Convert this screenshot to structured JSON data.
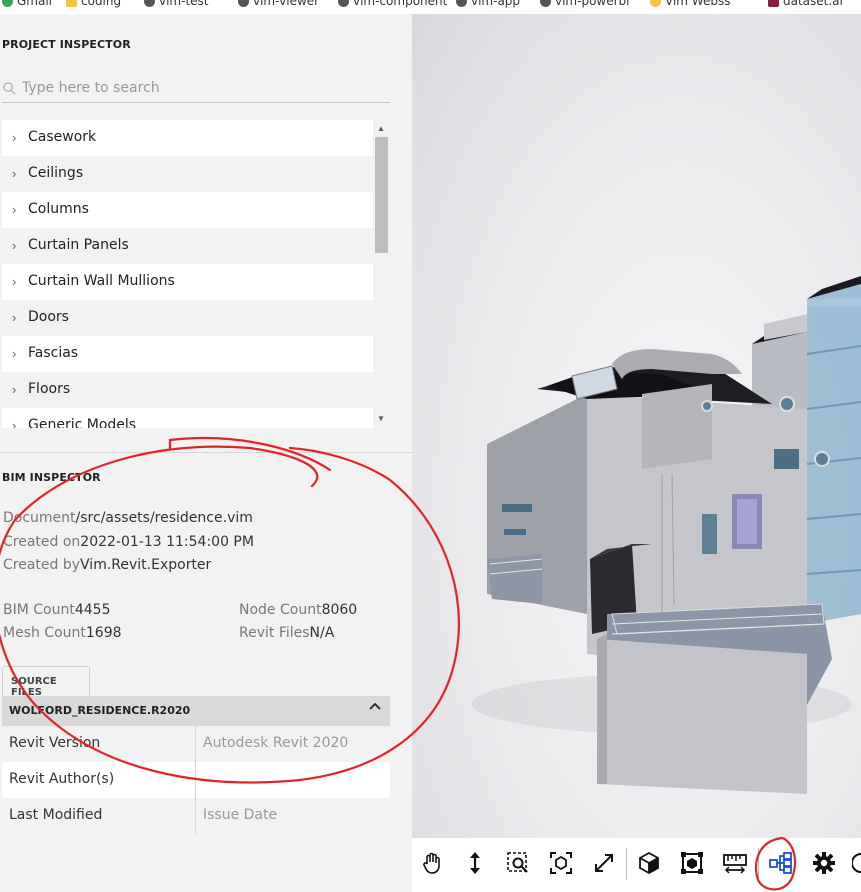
{
  "bookmarks": [
    "Gmail",
    "coding",
    "vim-test",
    "vim-viewer",
    "vim-component",
    "vim-app",
    "vim-powerbi",
    "Vim Webss",
    "dataset.ai"
  ],
  "project_inspector": {
    "title": "PROJECT INSPECTOR",
    "search_placeholder": "Type here to search",
    "categories": [
      "Casework",
      "Ceilings",
      "Columns",
      "Curtain Panels",
      "Curtain Wall Mullions",
      "Doors",
      "Fascias",
      "Floors",
      "Generic Models"
    ]
  },
  "bim_inspector": {
    "title": "BIM INSPECTOR",
    "document_label": "Document",
    "document_value": "/src/assets/residence.vim",
    "created_on_label": "Created on",
    "created_on_value": "2022-01-13 11:54:00 PM",
    "created_by_label": "Created by",
    "created_by_value": "Vim.Revit.Exporter",
    "bim_count_label": "BIM Count",
    "bim_count_value": "4455",
    "node_count_label": "Node Count",
    "node_count_value": "8060",
    "mesh_count_label": "Mesh Count",
    "mesh_count_value": "1698",
    "revit_files_label": "Revit Files",
    "revit_files_value": "N/A"
  },
  "source_files": {
    "tab_label": "SOURCE FILES",
    "file_name": "WOLFORD_RESIDENCE.R2020",
    "rows": [
      {
        "label": "Revit Version",
        "value": "Autodesk Revit 2020"
      },
      {
        "label": "Revit Author(s)",
        "value": ""
      },
      {
        "label": "Last Modified",
        "value": "Issue Date"
      }
    ]
  },
  "toolbar": {
    "buttons": [
      "hand-pan-icon",
      "zoom-updown-icon",
      "zoom-window-icon",
      "frame-selection-icon",
      "fullscreen-icon",
      "isolate-cube-icon",
      "section-box-icon",
      "measure-icon",
      "tree-hierarchy-icon",
      "settings-gear-icon",
      "help-icon"
    ]
  },
  "colors": {
    "panel_bg": "#f2f2f2",
    "accent_blue": "#1f4fd8",
    "annotation_red": "#e0242a"
  }
}
